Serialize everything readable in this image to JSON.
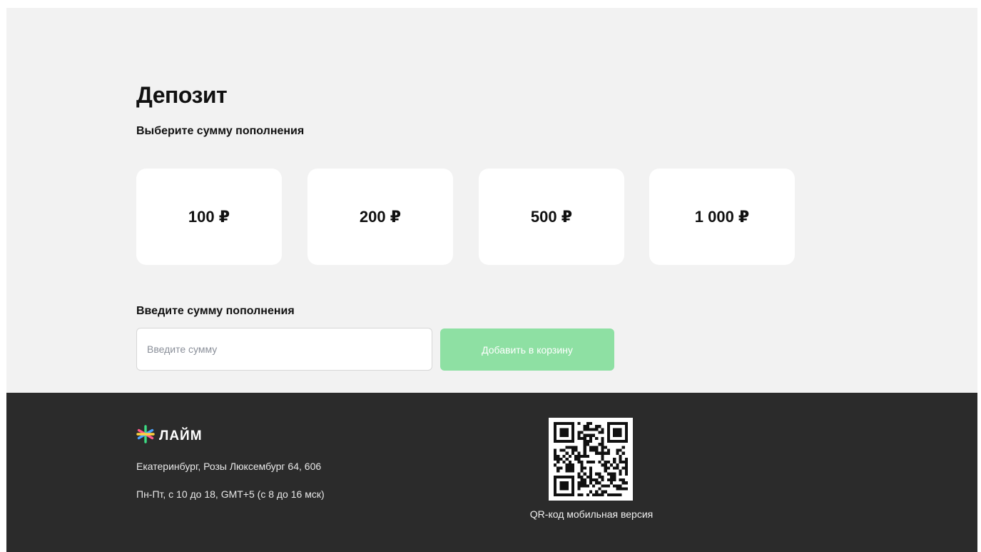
{
  "deposit": {
    "title": "Депозит",
    "subtitle": "Выберите сумму пополнения",
    "amounts": [
      {
        "label": "100 ₽"
      },
      {
        "label": "200 ₽"
      },
      {
        "label": "500 ₽"
      },
      {
        "label": "1 000 ₽"
      }
    ],
    "custom_amount": {
      "label": "Введите сумму пополнения",
      "placeholder": "Введите сумму",
      "value": ""
    },
    "add_to_cart_label": "Добавить в корзину"
  },
  "footer": {
    "logo_text": "ЛАЙМ",
    "logo_icon": "lime-asterisk-logo-icon",
    "address": "Екатеринбург, Розы Люксембург 64, 606",
    "hours": "Пн-Пт, с 10 до 18, GMT+5 (с 8 до 16 мск)",
    "qr_caption": "QR-код мобильная версия"
  },
  "colors": {
    "page_background": "#f2f2f2",
    "card_background": "#ffffff",
    "button_disabled_green": "#8ee0a3",
    "footer_background": "#2b2b2b"
  }
}
